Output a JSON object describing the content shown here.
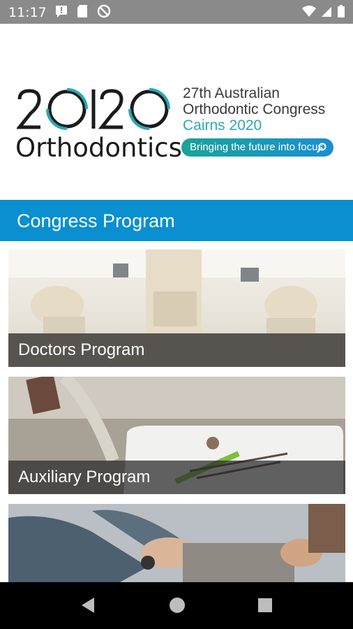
{
  "status_bar": {
    "time": "11:17",
    "icons": [
      "message-alert-icon",
      "sd-card-icon",
      "do-not-disturb-icon",
      "wifi-icon",
      "signal-icon",
      "battery-icon"
    ]
  },
  "logo": {
    "number_text": "2020",
    "brand": "Orthodontics",
    "line1": "27th Australian",
    "line2": "Orthodontic Congress",
    "line3": "Cairns 2020",
    "tagline": "Bringing the future into focus",
    "colors": {
      "accent_teal": "#2aa7b8",
      "tagline_start": "#1aa39a",
      "tagline_end": "#1a8fd0"
    }
  },
  "header": {
    "title": "Congress Program",
    "color": "#0a8fd1"
  },
  "programs": [
    {
      "label": "Doctors Program"
    },
    {
      "label": "Auxiliary Program"
    },
    {
      "label": ""
    }
  ],
  "nav_bar": {
    "buttons": [
      "back-icon",
      "home-icon",
      "recents-icon"
    ]
  }
}
